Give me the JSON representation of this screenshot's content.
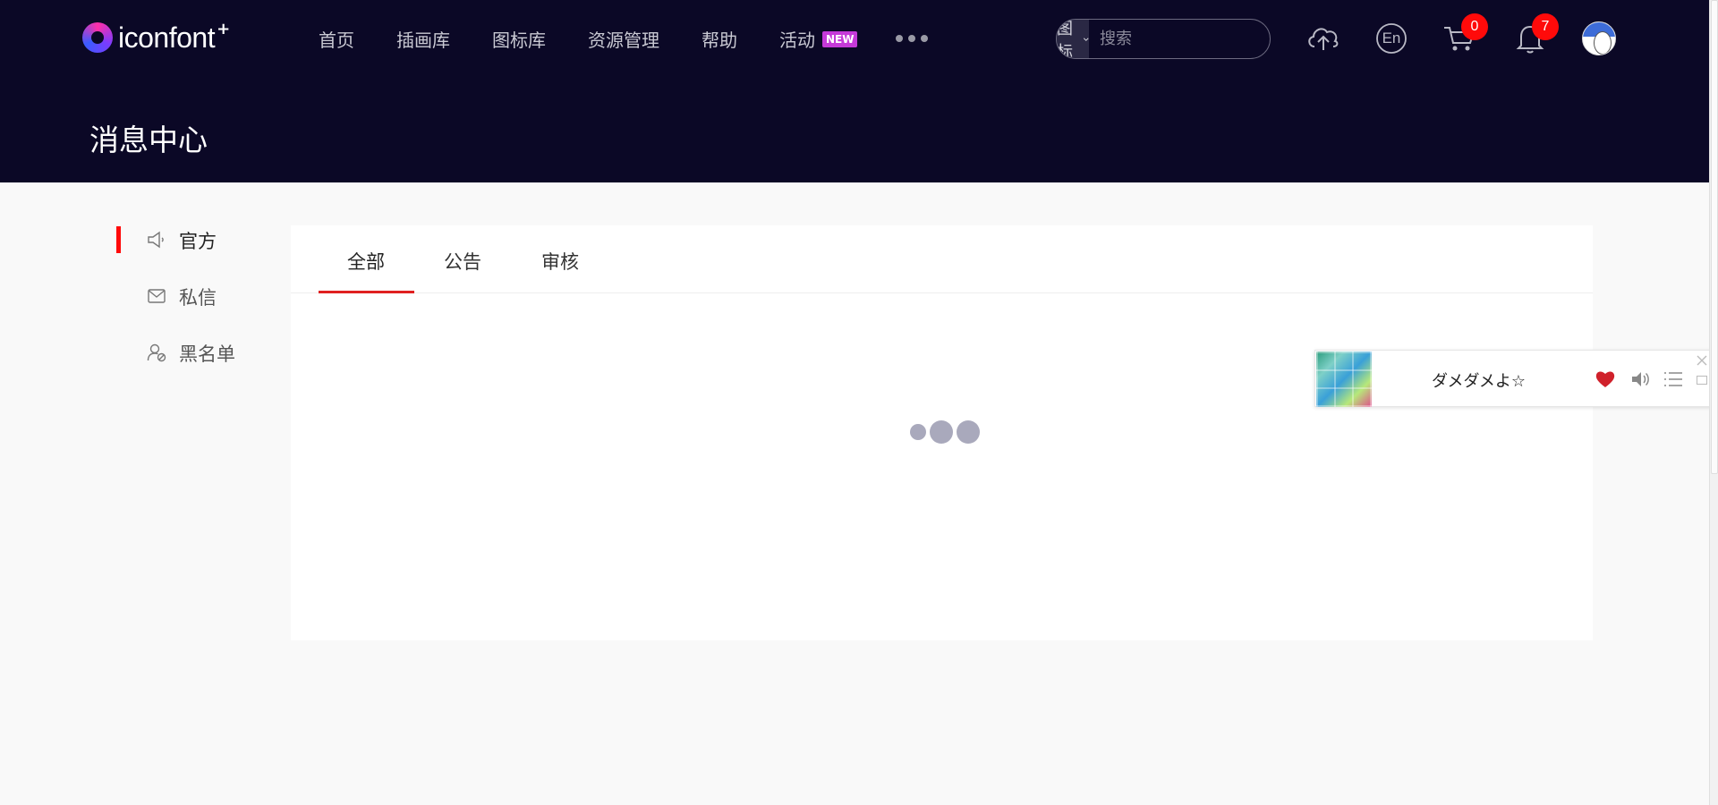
{
  "brand": {
    "name": "iconfont",
    "plus": "+"
  },
  "nav": {
    "items": [
      {
        "label": "首页"
      },
      {
        "label": "插画库"
      },
      {
        "label": "图标库"
      },
      {
        "label": "资源管理"
      },
      {
        "label": "帮助"
      },
      {
        "label": "活动",
        "badge": "NEW"
      }
    ]
  },
  "search": {
    "type": "图标",
    "placeholder": "搜索"
  },
  "actions": {
    "language": "En",
    "cart_count": "0",
    "notification_count": "7"
  },
  "page": {
    "title": "消息中心"
  },
  "sidebar": {
    "items": [
      {
        "label": "官方",
        "icon": "megaphone-icon",
        "active": true
      },
      {
        "label": "私信",
        "icon": "mail-icon"
      },
      {
        "label": "黑名单",
        "icon": "user-block-icon"
      }
    ]
  },
  "tabs": {
    "items": [
      {
        "label": "全部",
        "active": true
      },
      {
        "label": "公告"
      },
      {
        "label": "审核"
      }
    ]
  },
  "music": {
    "title": "ダメダメよ☆"
  },
  "colors": {
    "header_bg": "#0b0826",
    "accent": "#e02020",
    "badge": "#ff0a0a",
    "new_badge": "#c53ad8"
  }
}
